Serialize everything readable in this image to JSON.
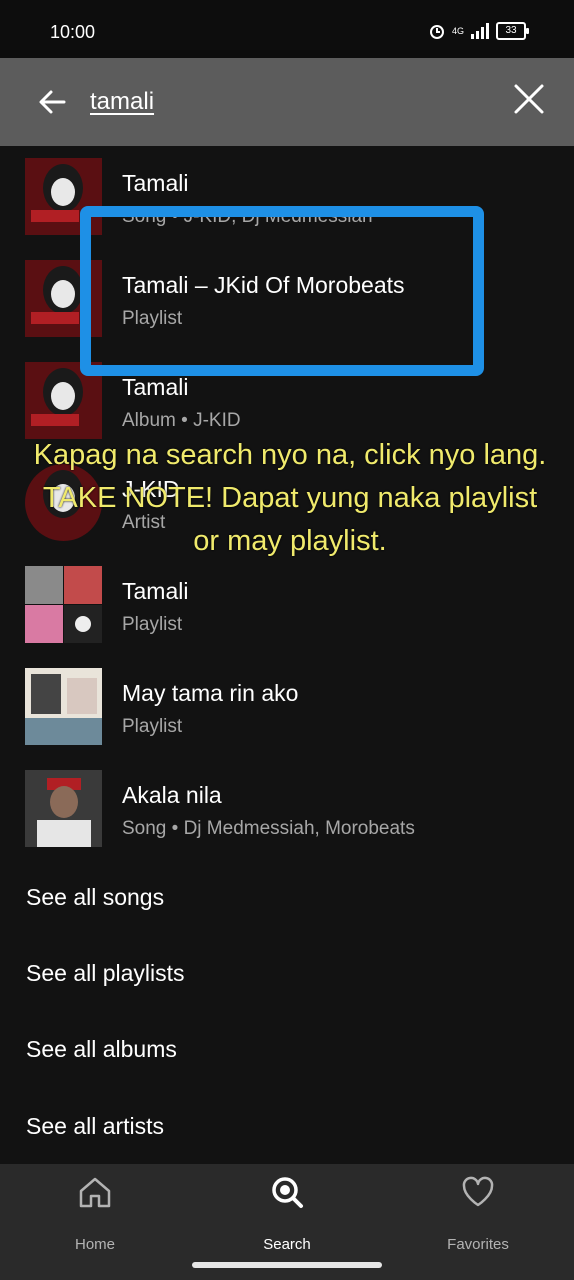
{
  "status_bar": {
    "time": "10:00",
    "network": "4G",
    "battery": "33"
  },
  "search": {
    "query": "tamali"
  },
  "results": [
    {
      "title": "Tamali",
      "subtitle": "Song • J-KID, Dj Medmessiah"
    },
    {
      "title": "Tamali – JKid Of Morobeats",
      "subtitle": "Playlist"
    },
    {
      "title": "Tamali",
      "subtitle": "Album • J-KID"
    },
    {
      "title": "J-KID",
      "subtitle": "Artist"
    },
    {
      "title": "Tamali",
      "subtitle": "Playlist"
    },
    {
      "title": "May tama rin ako",
      "subtitle": "Playlist"
    },
    {
      "title": "Akala nila",
      "subtitle": "Song • Dj Medmessiah, Morobeats"
    }
  ],
  "see_all": {
    "songs": "See all songs",
    "playlists": "See all playlists",
    "albums": "See all albums",
    "artists": "See all artists"
  },
  "annotation": {
    "text": "Kapag na search nyo na, click nyo lang. TAKE NOTE! Dapat yung naka playlist or may playlist.",
    "highlight_color": "#1e90e6",
    "text_color": "#f0ea6c"
  },
  "bottom_nav": {
    "home": "Home",
    "search": "Search",
    "favorites": "Favorites"
  },
  "colors": {
    "background": "#121212",
    "header": "#5c5c5c",
    "subtitle": "#a7a7a7"
  }
}
